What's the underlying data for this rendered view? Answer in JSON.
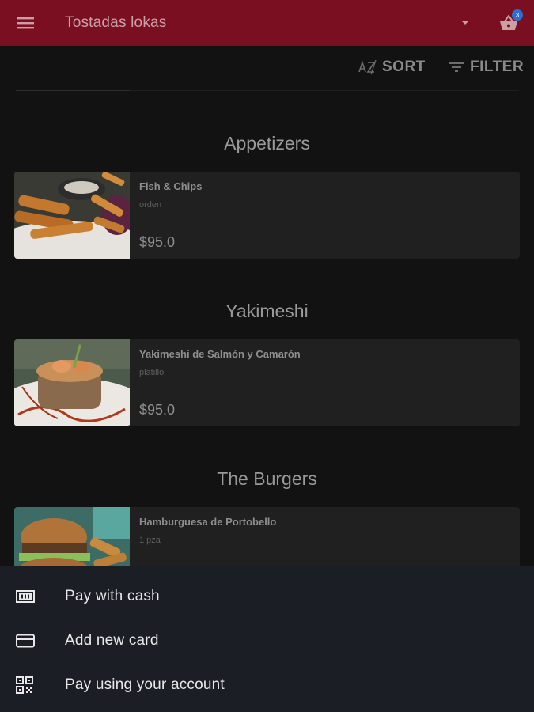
{
  "appbar": {
    "title": "Tostadas lokas",
    "cart_count": "3"
  },
  "toolbar": {
    "sort_label": "SORT",
    "filter_label": "FILTER"
  },
  "sections": [
    {
      "title": "Appetizers",
      "item": {
        "name": "Fish & Chips",
        "unit": "orden",
        "price": "$95.0"
      }
    },
    {
      "title": "Yakimeshi",
      "item": {
        "name": "Yakimeshi de Salmón y Camarón",
        "unit": "platillo",
        "price": "$95.0"
      }
    },
    {
      "title": "The Burgers",
      "item": {
        "name": "Hamburguesa de Portobello",
        "unit": "1 pza",
        "price": ""
      }
    }
  ],
  "payment_sheet": {
    "options": [
      {
        "label": "Pay with cash",
        "icon": "cash-icon"
      },
      {
        "label": "Add new card",
        "icon": "credit-card-icon"
      },
      {
        "label": "Pay using your account",
        "icon": "qr-code-icon"
      }
    ]
  },
  "colors": {
    "appbar": "#7a0f22",
    "background": "#121212",
    "card": "#202020",
    "sheet": "#1c1e26",
    "badge": "#2a6fd6"
  }
}
